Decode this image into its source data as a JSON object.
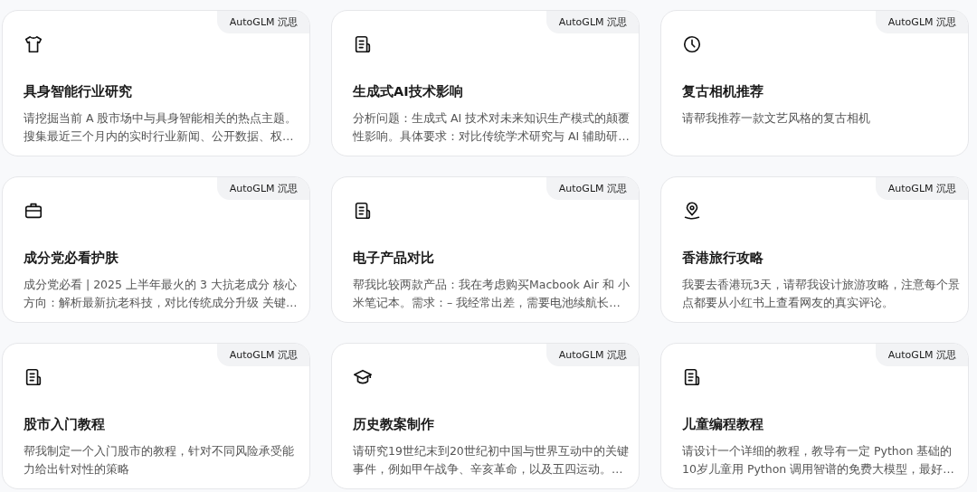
{
  "cards": [
    {
      "kind": "shirt",
      "badge": "AutoGLM 沉思",
      "title": "具身智能行业研究",
      "description": "请挖掘当前 A 股市场中与具身智能相关的热点主题。搜集最近三个月内的实时行业新闻、公开数据、权…"
    },
    {
      "kind": "document",
      "badge": "AutoGLM 沉思",
      "title": "生成式AI技术影响",
      "description": "分析问题：生成式 AI 技术对未来知识生产模式的颠覆性影响。具体要求：对比传统学术研究与 AI 辅助研…"
    },
    {
      "kind": "clock",
      "badge": "AutoGLM 沉思",
      "title": "复古相机推荐",
      "description": "请帮我推荐一款文艺风格的复古相机"
    },
    {
      "kind": "briefcase",
      "badge": "AutoGLM 沉思",
      "title": "成分党必看护肤",
      "description": "成分党必看 | 2025 上半年最火的 3 大抗老成分 核心方向：解析最新抗老科技，对比传统成分升级 关键…"
    },
    {
      "kind": "document",
      "badge": "AutoGLM 沉思",
      "title": "电子产品对比",
      "description": "帮我比较两款产品：我在考虑购买Macbook Air 和 小米笔记本。需求：– 我经常出差，需要电池续航长…"
    },
    {
      "kind": "pin",
      "badge": "AutoGLM 沉思",
      "title": "香港旅行攻略",
      "description": "我要去香港玩3天，请帮我设计旅游攻略，注意每个景点都要从小红书上查看网友的真实评论。"
    },
    {
      "kind": "document",
      "badge": "AutoGLM 沉思",
      "title": "股市入门教程",
      "description": "帮我制定一个入门股市的教程，针对不同风险承受能力给出针对性的策略"
    },
    {
      "kind": "cap",
      "badge": "AutoGLM 沉思",
      "title": "历史教案制作",
      "description": "请研究19世纪末到20世纪初中国与世界互动中的关键事件，例如甲午战争、辛亥革命，以及五四运动。…"
    },
    {
      "kind": "document",
      "badge": "AutoGLM 沉思",
      "title": "儿童编程教程",
      "description": "请设计一个详细的教程，教导有一定 Python 基础的10岁儿童用 Python 调用智谱的免费大模型，最好…"
    }
  ]
}
